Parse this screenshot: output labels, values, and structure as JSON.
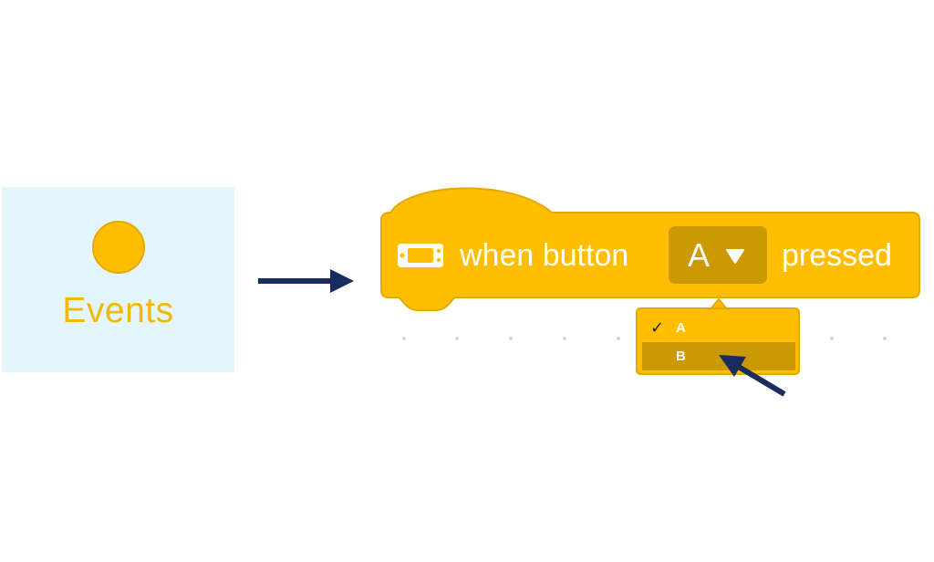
{
  "category": {
    "label": "Events",
    "color": "#ffbf00",
    "panel_color": "#e5f5fc"
  },
  "block": {
    "icon": "device-icon",
    "text_before": "when button",
    "selected_value": "A",
    "text_after": "pressed",
    "color": "#ffbf00",
    "field_color": "#cc9a00"
  },
  "dropdown_menu": {
    "items": [
      {
        "label": "A",
        "checked": true,
        "highlighted": false
      },
      {
        "label": "B",
        "checked": false,
        "highlighted": true
      }
    ],
    "check_mark": "✓"
  },
  "annotations": {
    "arrow_color": "#1a2b5e"
  }
}
